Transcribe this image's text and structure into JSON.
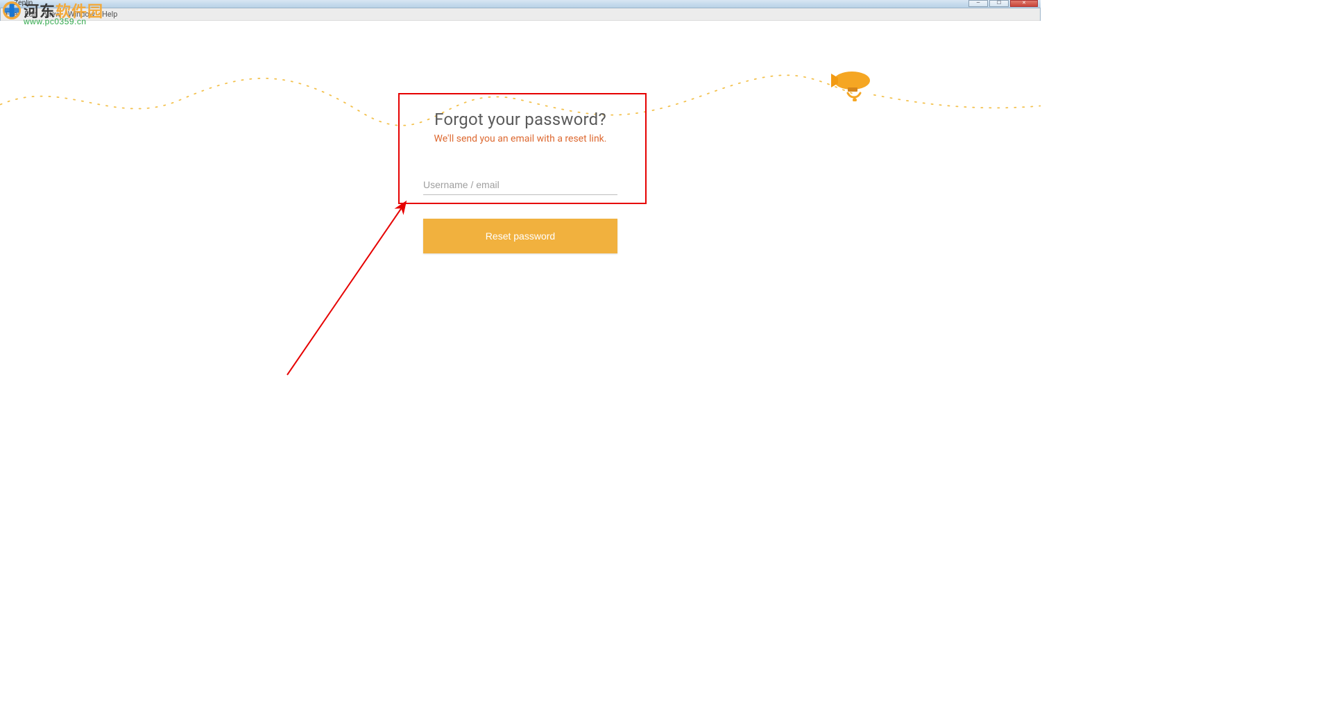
{
  "window": {
    "title": "Zeplin",
    "controls": {
      "minimize": "—",
      "maximize": "☐",
      "close": "✕"
    }
  },
  "menubar": {
    "items": [
      "File",
      "Edit",
      "View",
      "Window",
      "Help"
    ]
  },
  "watermark": {
    "text_cn_plain": "河东",
    "text_cn_accent": "软件园",
    "url": "www.pc0359.cn"
  },
  "card": {
    "title": "Forgot your password?",
    "subtitle": "We'll send you an email with a reset link.",
    "placeholder": "Username / email",
    "value": "",
    "button": "Reset password"
  }
}
